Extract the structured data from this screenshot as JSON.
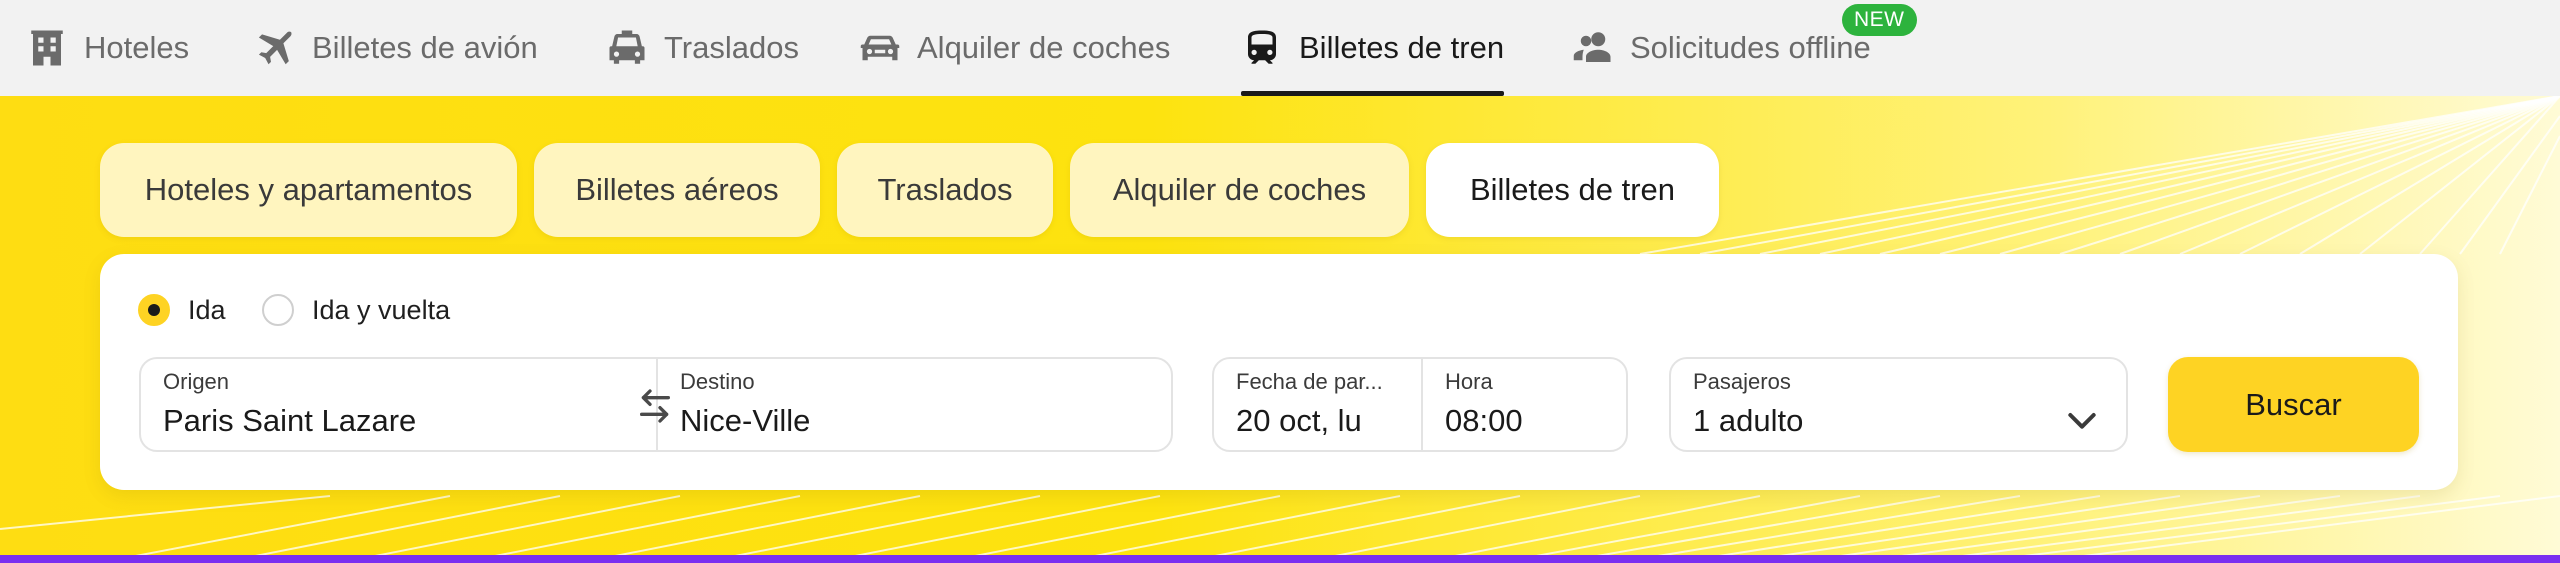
{
  "nav": {
    "items": [
      {
        "label": "Hoteles",
        "icon": "hotel-icon"
      },
      {
        "label": "Billetes de avión",
        "icon": "plane-icon"
      },
      {
        "label": "Traslados",
        "icon": "car-front-icon"
      },
      {
        "label": "Alquiler de coches",
        "icon": "car-icon"
      },
      {
        "label": "Billetes de tren",
        "icon": "train-icon",
        "active": true
      },
      {
        "label": "Solicitudes offline",
        "icon": "users-icon"
      }
    ],
    "new_badge": "NEW"
  },
  "tabs": [
    {
      "label": "Hoteles y apartamentos"
    },
    {
      "label": "Billetes aéreos"
    },
    {
      "label": "Traslados"
    },
    {
      "label": "Alquiler de coches"
    },
    {
      "label": "Billetes de tren",
      "active": true
    }
  ],
  "trip_type": {
    "options": [
      {
        "label": "Ida",
        "selected": true
      },
      {
        "label": "Ida y vuelta",
        "selected": false
      }
    ]
  },
  "search": {
    "origin_label": "Origen",
    "origin_value": "Paris Saint Lazare",
    "destination_label": "Destino",
    "destination_value": "Nice-Ville",
    "date_label": "Fecha de par...",
    "date_value": "20 oct, lu",
    "time_label": "Hora",
    "time_value": "08:00",
    "passengers_label": "Pasajeros",
    "passengers_value": "1 adulto",
    "button_label": "Buscar"
  },
  "colors": {
    "accent_yellow": "#fed323",
    "hero_yellow": "#fedd12",
    "new_badge_green": "#2db33d",
    "bottom_bar_purple": "#7a2ff0"
  }
}
